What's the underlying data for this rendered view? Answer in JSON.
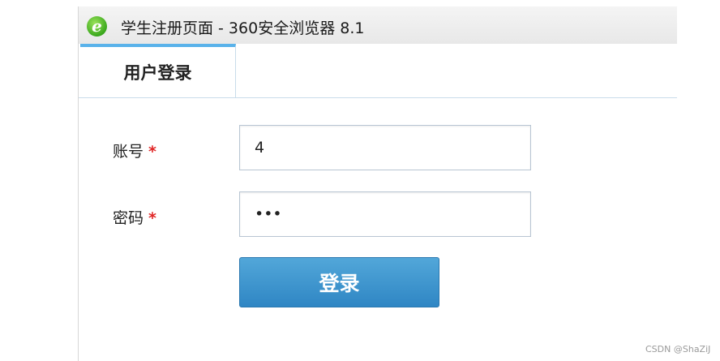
{
  "window": {
    "title": "学生注册页面 - 360安全浏览器 8.1",
    "icon": "browser-e-icon"
  },
  "tabs": [
    {
      "label": "用户登录",
      "active": true
    }
  ],
  "form": {
    "account": {
      "label": "账号",
      "required_mark": "*",
      "value": "4"
    },
    "password": {
      "label": "密码",
      "required_mark": "*",
      "value": "•••"
    },
    "submit_label": "登录"
  },
  "watermark": "CSDN @ShaZiJ",
  "colors": {
    "tab_accent": "#59b2ea",
    "button": "#3b92cc",
    "required": "#e02424"
  }
}
